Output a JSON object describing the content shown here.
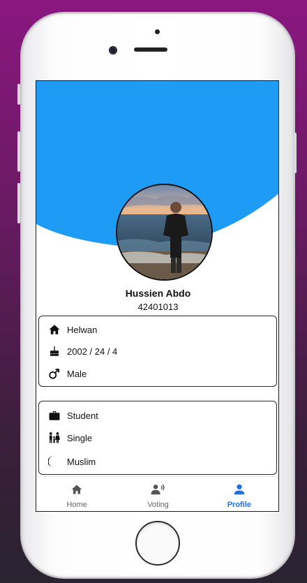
{
  "profile": {
    "name": "Hussien Abdo",
    "id": "42401013"
  },
  "personal_info": [
    {
      "icon": "house-icon",
      "label": "Helwan"
    },
    {
      "icon": "birthday-cake-icon",
      "label": "2002 / 24 / 4"
    },
    {
      "icon": "male-symbol-icon",
      "label": "Male"
    }
  ],
  "status_info": [
    {
      "icon": "briefcase-icon",
      "label": "Student"
    },
    {
      "icon": "family-icon",
      "label": "Single"
    },
    {
      "icon": "crescent-moon-icon",
      "label": "Muslim"
    }
  ],
  "nav": {
    "home": "Home",
    "voting": "Voting",
    "profile": "Profile",
    "active": "profile"
  },
  "colors": {
    "header_blue": "#1e9bf5",
    "active_tab": "#1f6fe0",
    "background": "#8a1780"
  }
}
